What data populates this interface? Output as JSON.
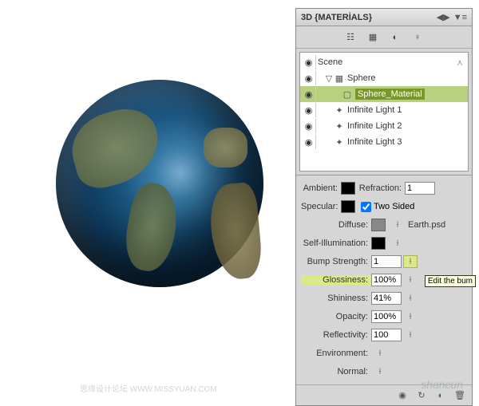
{
  "panel": {
    "title": "3D {MATERİALS}"
  },
  "tree": {
    "scene": "Scene",
    "sphere": "Sphere",
    "material": "Sphere_Material",
    "light1": "Infinite Light 1",
    "light2": "Infinite Light 2",
    "light3": "Infinite Light 3"
  },
  "props": {
    "ambient": {
      "label": "Ambient:",
      "color": "#000000"
    },
    "refraction": {
      "label": "Refraction:",
      "value": "1"
    },
    "specular": {
      "label": "Specular:",
      "color": "#000000"
    },
    "twosided": {
      "label": "Two Sided",
      "checked": true
    },
    "diffuse": {
      "label": "Diffuse:",
      "file": "Earth.psd"
    },
    "selfillum": {
      "label": "Self-Illumination:",
      "color": "#000000"
    },
    "bump": {
      "label": "Bump Strength:",
      "value": "1"
    },
    "glossiness": {
      "label": "Glossiness:",
      "value": "100%"
    },
    "shininess": {
      "label": "Shininess:",
      "value": "41%"
    },
    "opacity": {
      "label": "Opacity:",
      "value": "100%"
    },
    "reflectivity": {
      "label": "Reflectivity:",
      "value": "100"
    },
    "environment": {
      "label": "Environment:"
    },
    "normal": {
      "label": "Normal:"
    }
  },
  "tooltip": "Edit the bum",
  "watermark": {
    "main": "shancun",
    "sub": "思缘设计论坛   WWW.MISSYUAN.COM"
  }
}
